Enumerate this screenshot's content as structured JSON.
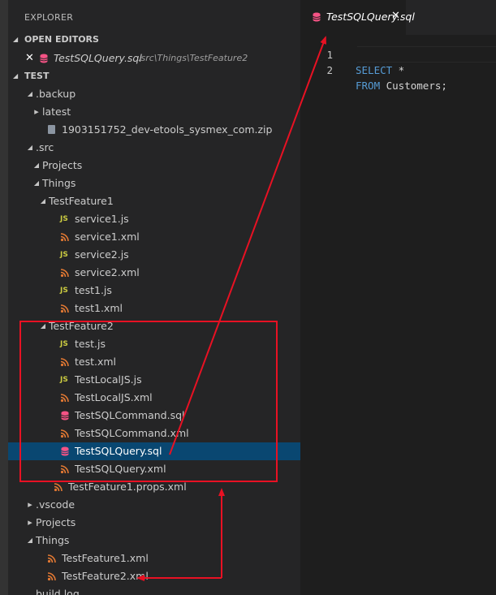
{
  "sidebar": {
    "title": "EXPLORER",
    "open_editors_header": "OPEN EDITORS",
    "open_editor": {
      "name": "TestSQLQuery.sql",
      "path": ".src\\Things\\TestFeature2",
      "close_glyph": "✕"
    },
    "workspace_header": "TEST",
    "tree": [
      {
        "label": ".backup",
        "indent": 1,
        "kind": "folder",
        "expanded": true
      },
      {
        "label": "latest",
        "indent": 2,
        "kind": "folder",
        "expanded": false
      },
      {
        "label": "1903151752_dev-etools_sysmex_com.zip",
        "indent": 2,
        "kind": "zip"
      },
      {
        "label": ".src",
        "indent": 1,
        "kind": "folder",
        "expanded": true
      },
      {
        "label": "Projects",
        "indent": 2,
        "kind": "folder",
        "expanded": true
      },
      {
        "label": "Things",
        "indent": 2,
        "kind": "folder",
        "expanded": true
      },
      {
        "label": "TestFeature1",
        "indent": 3,
        "kind": "folder",
        "expanded": true
      },
      {
        "label": "service1.js",
        "indent": 4,
        "kind": "js"
      },
      {
        "label": "service1.xml",
        "indent": 4,
        "kind": "xml"
      },
      {
        "label": "service2.js",
        "indent": 4,
        "kind": "js"
      },
      {
        "label": "service2.xml",
        "indent": 4,
        "kind": "xml"
      },
      {
        "label": "test1.js",
        "indent": 4,
        "kind": "js"
      },
      {
        "label": "test1.xml",
        "indent": 4,
        "kind": "xml"
      },
      {
        "label": "TestFeature2",
        "indent": 3,
        "kind": "folder",
        "expanded": true
      },
      {
        "label": "test.js",
        "indent": 4,
        "kind": "js"
      },
      {
        "label": "test.xml",
        "indent": 4,
        "kind": "xml"
      },
      {
        "label": "TestLocalJS.js",
        "indent": 4,
        "kind": "js"
      },
      {
        "label": "TestLocalJS.xml",
        "indent": 4,
        "kind": "xml"
      },
      {
        "label": "TestSQLCommand.sql",
        "indent": 4,
        "kind": "sql"
      },
      {
        "label": "TestSQLCommand.xml",
        "indent": 4,
        "kind": "xml"
      },
      {
        "label": "TestSQLQuery.sql",
        "indent": 4,
        "kind": "sql",
        "selected": true
      },
      {
        "label": "TestSQLQuery.xml",
        "indent": 4,
        "kind": "xml"
      },
      {
        "label": "TestFeature1.props.xml",
        "indent": 3,
        "kind": "xml"
      },
      {
        "label": ".vscode",
        "indent": 1,
        "kind": "folder",
        "expanded": false
      },
      {
        "label": "Projects",
        "indent": 1,
        "kind": "folder",
        "expanded": false
      },
      {
        "label": "Things",
        "indent": 1,
        "kind": "folder",
        "expanded": true
      },
      {
        "label": "TestFeature1.xml",
        "indent": 2,
        "kind": "xml"
      },
      {
        "label": "TestFeature2.xml",
        "indent": 2,
        "kind": "xml"
      },
      {
        "label": "build.log",
        "indent": 1,
        "kind": "file"
      }
    ]
  },
  "editor": {
    "tab": {
      "label": "TestSQLQuery.sql",
      "close_glyph": "✕"
    },
    "lines": [
      {
        "number": "1",
        "tokens": [
          {
            "text": "SELECT",
            "type": "keyword"
          },
          {
            "text": " *",
            "type": "text"
          }
        ]
      },
      {
        "number": "2",
        "tokens": [
          {
            "text": "FROM",
            "type": "keyword"
          },
          {
            "text": " Customers;",
            "type": "text"
          }
        ]
      }
    ]
  },
  "colors": {
    "sidebar_bg": "#252526",
    "editor_bg": "#1e1e1e",
    "selection_bg": "#094771",
    "keyword": "#569cd6",
    "annotation_red": "#e81123",
    "js_icon": "#cbcb41",
    "xml_icon": "#e37933",
    "sql_icon": "#f55385"
  },
  "icons": {
    "folder_expanded": "triangle-down",
    "folder_collapsed": "triangle-right",
    "js": "js-icon",
    "xml": "rss-icon",
    "sql": "database-icon",
    "zip": "zip-icon"
  }
}
